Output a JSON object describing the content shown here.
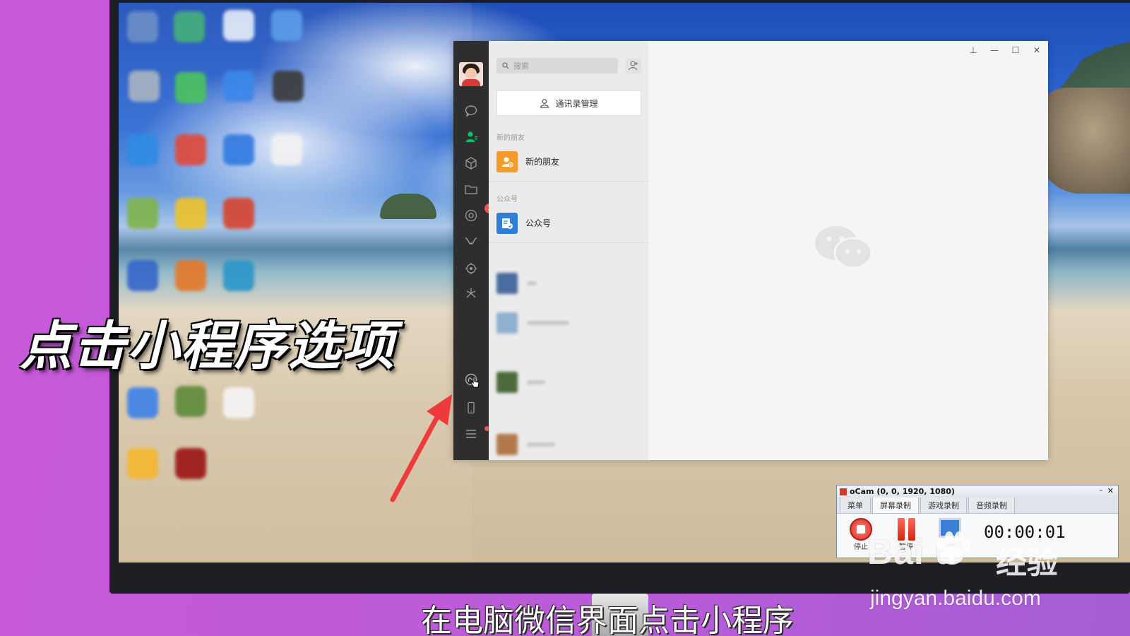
{
  "wechat": {
    "search_placeholder": "搜索",
    "contact_manage": "通讯录管理",
    "section_new_friends": "新的朋友",
    "new_friends": "新的朋友",
    "section_official": "公众号",
    "official_accounts": "公众号",
    "unread_badge": "1",
    "window_controls": [
      "pin",
      "minimize",
      "maximize",
      "close"
    ]
  },
  "ocam": {
    "title": "oCam (0, 0, 1920, 1080)",
    "tabs": [
      "菜单",
      "屏幕录制",
      "游戏录制",
      "音频录制"
    ],
    "active_tab": "屏幕录制",
    "stop_label": "停止",
    "pause_label": "暂停",
    "timer": "00:00:01"
  },
  "overlay": {
    "headline": "点击小程序选项",
    "caption": "在电脑微信界面点击小程序"
  },
  "watermark": {
    "brand": "Bai  u",
    "brand_cn": "经验",
    "url": "jingyan.baidu.com"
  },
  "colors": {
    "backdrop": "#c45fd6",
    "wechat_sidebar": "#2e2e2e",
    "wechat_green": "#07c160",
    "badge_red": "#f05050",
    "arrow_red": "#ee3a3a"
  }
}
